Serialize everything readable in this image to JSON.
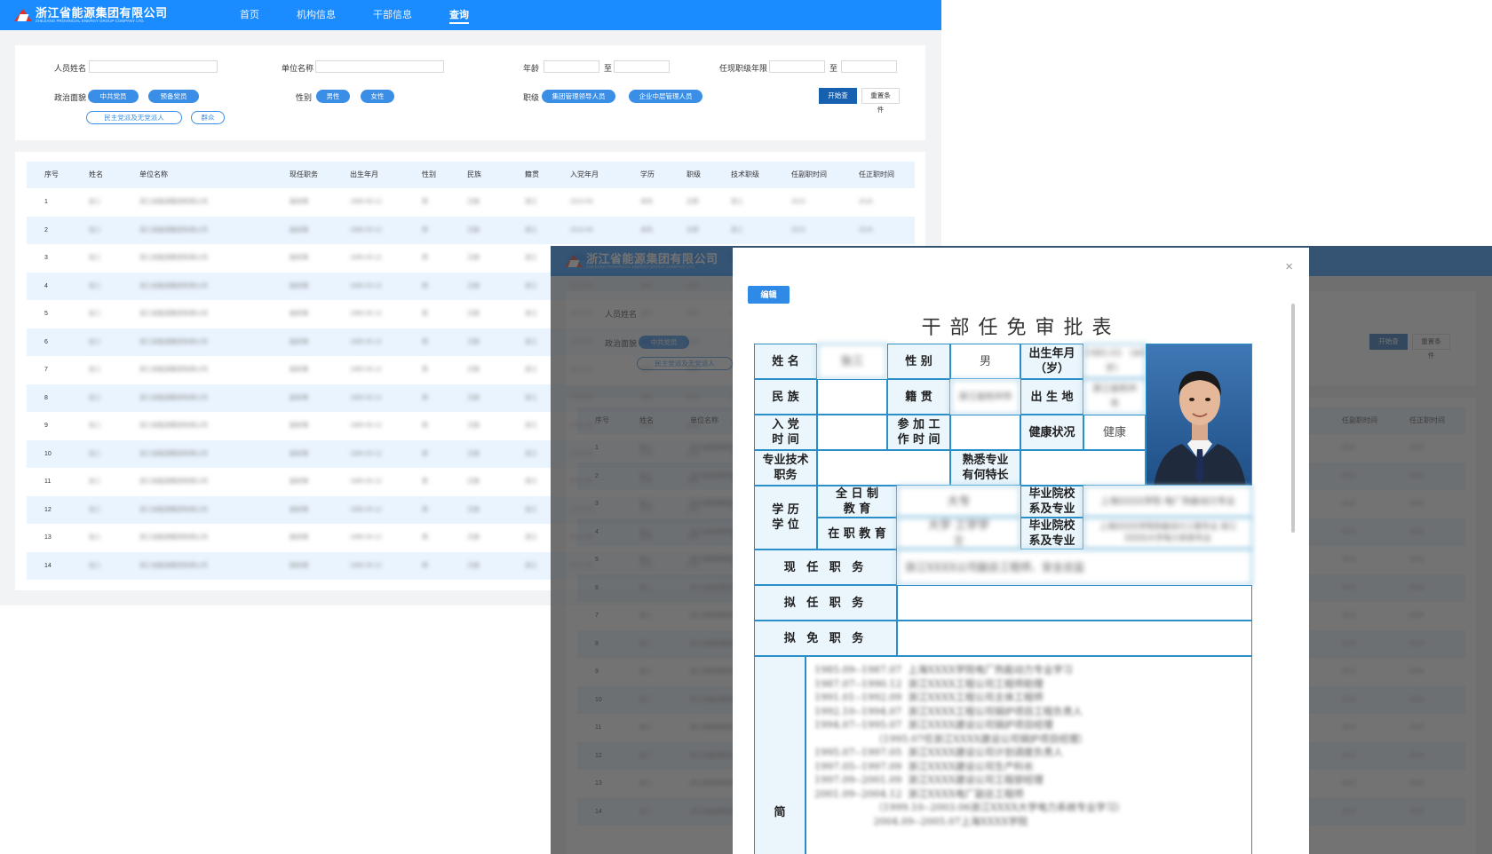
{
  "brand": {
    "name_cn": "浙江省能源集团有限公司",
    "name_en": "ZHEJIANG PROVINCIAL ENERGY GROUP COMPANY LTD."
  },
  "nav": [
    {
      "label": "首页"
    },
    {
      "label": "机构信息"
    },
    {
      "label": "干部信息"
    },
    {
      "label": "查询"
    }
  ],
  "filters": {
    "name_label": "人员姓名",
    "unit_label": "单位名称",
    "age_label": "年龄",
    "to_1": "至",
    "rank_years_label": "任现职级年限",
    "to_2": "至",
    "political_label": "政治面貌",
    "political_options": [
      "中共党员",
      "预备党员",
      "民主党派及无党派人",
      "群众"
    ],
    "gender_label": "性别",
    "gender_options": [
      "男性",
      "女性"
    ],
    "level_label": "职级",
    "level_options": [
      "集团管理领导人员",
      "企业中层管理人员"
    ],
    "search_btn": "开始查询",
    "reset_btn": "重置条件"
  },
  "table": {
    "headers": [
      "序号",
      "姓名",
      "单位名称",
      "现任职务",
      "出生年月",
      "性别",
      "民族",
      "籍贯",
      "入党年月",
      "学历",
      "职级",
      "技术职级",
      "任副职时间",
      "任正职时间"
    ],
    "row_numbers": [
      "1",
      "2",
      "3",
      "4",
      "5",
      "6",
      "7",
      "8",
      "9",
      "10",
      "11",
      "12",
      "13",
      "14"
    ],
    "cells": {
      "name": "张三",
      "unit": "浙江省能源集团有限公司",
      "position": "副经理",
      "birth": "1985-05-12",
      "gender": "男",
      "ethnic": "汉族",
      "native": "浙江",
      "party": "2010-06",
      "edu": "本科",
      "level": "正职",
      "tech": "高工",
      "vice": "2015",
      "chief": "2018"
    }
  },
  "dialog": {
    "close": "×",
    "edit_btn": "编辑",
    "title": "干部任免审批表",
    "labels": {
      "name": "姓 名",
      "gender": "性 别",
      "birth": "出生年月（岁）",
      "ethnic": "民 族",
      "native": "籍 贯",
      "birthplace": "出 生 地",
      "party": "入 党 时 间",
      "work": "参 加 工 作 时 间",
      "health": "健康状况",
      "tech": "专业技术职务",
      "skill": "熟悉专业有何特长",
      "degree": "学 历 学 位",
      "fulltime": "全 日 制 教 育",
      "school1": "毕业院校系及专业",
      "inservice": "在 职 教 育",
      "school2": "毕业院校系及专业",
      "current": "现 任 职 务",
      "proposed": "拟 任 职 务",
      "removed": "拟 免 职 务",
      "resume": "简"
    },
    "values": {
      "name": "张三",
      "gender": "男",
      "birth": "1985.03 （40岁）",
      "native": "浙江省杭州市",
      "birthplace": "浙江省杭州市",
      "health": "健康",
      "fulltime": "大专",
      "school1": "上海XXXX学院 电厂热能动力专业",
      "inservice": "大学 工学学士",
      "school2": "上海XXXX学院热能动力工程专业 浙江XXXX大学电力系统专业",
      "current": "浙江XXXX公司副总工程师、安全总监"
    },
    "resume": [
      "1985.09--1987.07  上海XXXX学院电厂热能动力专业学习",
      "1987.07--1990.12  浙江XXXX工程公司工程师助理",
      "1991.01--1992.09  浙江XXXX工程公司主体工程师",
      "1992.10--1994.07  浙江XXXX工程公司锅炉项目工程负责人",
      "1994.07--1995.07  浙江XXXX建设公司锅炉项目经理",
      "                   （1995.07任浙江XXXX建设公司锅炉项目经理）",
      "1995.07--1997.05  浙江XXXX建设公司计划调度负责人",
      "1997.05--1997.09  浙江XXXX建设公司生产科长",
      "1997.09--2001.09  浙江XXXX建设公司工程部经理",
      "2001.09--2004.12  浙江XXXX电厂副总工程师",
      "                   （1999.10--2003.06浙江XXXX大学电力系统专业学习）",
      "                   2004.09--2005.07上海XXXX学院"
    ]
  }
}
